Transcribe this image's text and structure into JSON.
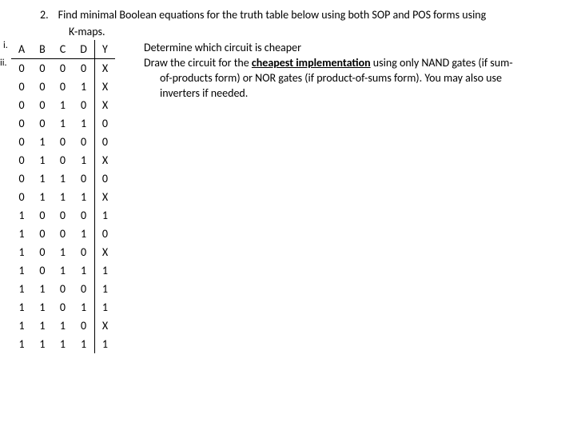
{
  "question": {
    "number": "2.",
    "text1": "Find minimal Boolean equations for the truth table below using both SOP and POS forms using",
    "text2": "K-maps.",
    "sub_i": "i.",
    "sub_ii": "ii.",
    "determine": "Determine which circuit is cheaper",
    "draw_prefix": "Draw the circuit for the ",
    "cheapest": "cheapest implementation",
    "draw_suffix": " using only NAND gates (if sum-",
    "draw_line2": "of-products form) or NOR gates (if product-of-sums form). You may also use",
    "draw_line3": "inverters if needed."
  },
  "table": {
    "headers": [
      "A",
      "B",
      "C",
      "D",
      "Y"
    ],
    "rows": [
      [
        "0",
        "0",
        "0",
        "0",
        "X"
      ],
      [
        "0",
        "0",
        "0",
        "1",
        "X"
      ],
      [
        "0",
        "0",
        "1",
        "0",
        "X"
      ],
      [
        "0",
        "0",
        "1",
        "1",
        "0"
      ],
      [
        "0",
        "1",
        "0",
        "0",
        "0"
      ],
      [
        "0",
        "1",
        "0",
        "1",
        "X"
      ],
      [
        "0",
        "1",
        "1",
        "0",
        "0"
      ],
      [
        "0",
        "1",
        "1",
        "1",
        "X"
      ],
      [
        "1",
        "0",
        "0",
        "0",
        "1"
      ],
      [
        "1",
        "0",
        "0",
        "1",
        "0"
      ],
      [
        "1",
        "0",
        "1",
        "0",
        "X"
      ],
      [
        "1",
        "0",
        "1",
        "1",
        "1"
      ],
      [
        "1",
        "1",
        "0",
        "0",
        "1"
      ],
      [
        "1",
        "1",
        "0",
        "1",
        "1"
      ],
      [
        "1",
        "1",
        "1",
        "0",
        "X"
      ],
      [
        "1",
        "1",
        "1",
        "1",
        "1"
      ]
    ]
  }
}
